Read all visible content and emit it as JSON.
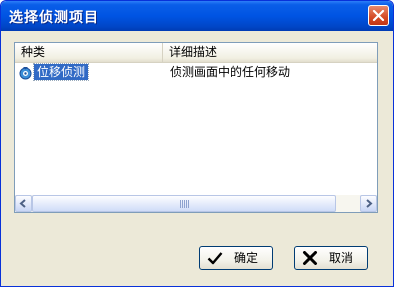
{
  "window": {
    "title": "选择侦测项目"
  },
  "listview": {
    "columns": [
      "种类",
      "详细描述"
    ],
    "rows": [
      {
        "name": "位移侦测",
        "description": "侦测画面中的任何移动",
        "icon": "motion-detect-icon",
        "selected": true
      }
    ]
  },
  "buttons": {
    "ok_label": "确定",
    "cancel_label": "取消"
  },
  "colors": {
    "titlebar": "#0054e3",
    "selection": "#316ac5",
    "close_button": "#d44a25"
  }
}
